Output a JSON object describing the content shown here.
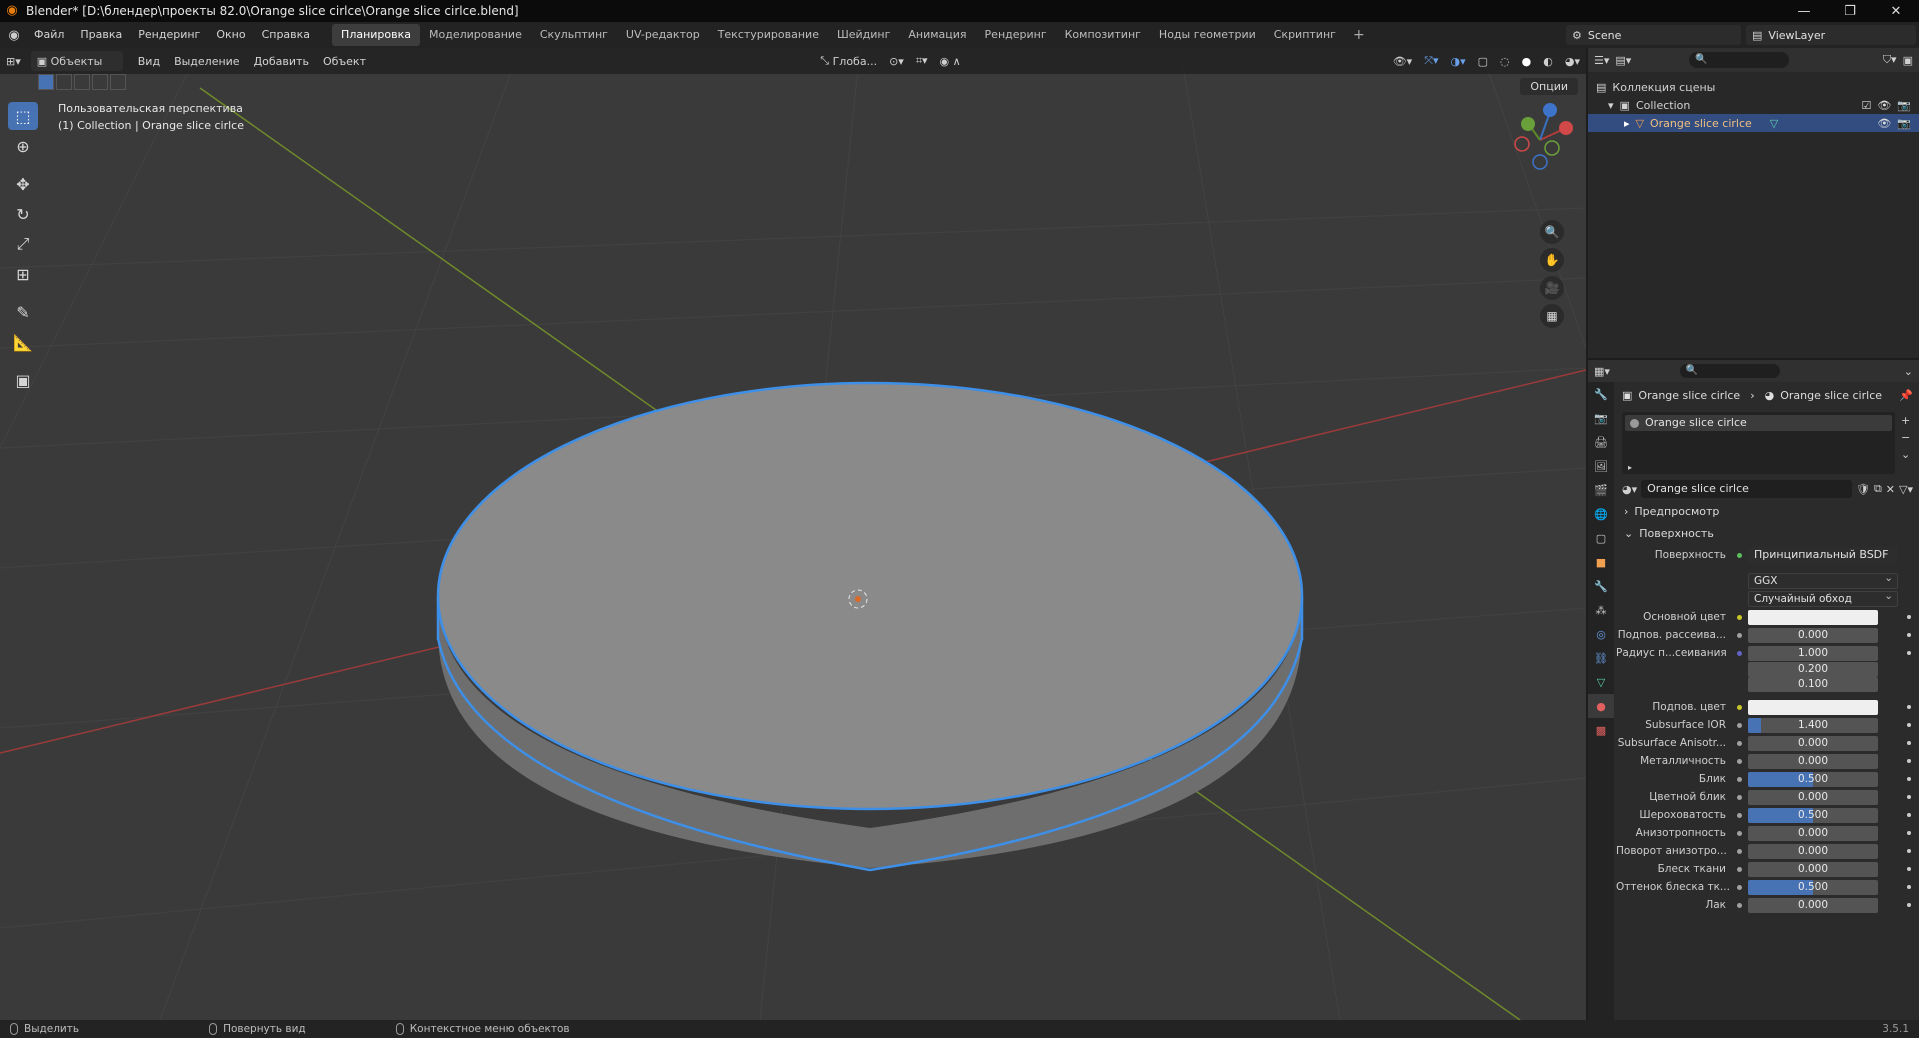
{
  "titlebar": {
    "title": "Blender* [D:\\блендер\\проекты 82.0\\Orange slice cirlce\\Orange slice cirlce.blend]",
    "minimize": "—",
    "restore": "❐",
    "close": "✕"
  },
  "topbar": {
    "menus": [
      "Файл",
      "Правка",
      "Рендеринг",
      "Окно",
      "Справка"
    ],
    "workspaces": [
      "Планировка",
      "Моделирование",
      "Скульптинг",
      "UV-редактор",
      "Текстурирование",
      "Шейдинг",
      "Анимация",
      "Рендеринг",
      "Композитинг",
      "Ноды геометрии",
      "Скриптинг"
    ],
    "active_workspace": "Планировка",
    "add_tab": "+",
    "scene": "Scene",
    "view_layer": "ViewLayer"
  },
  "viewport": {
    "mode": "Объекты",
    "menus": [
      "Вид",
      "Выделение",
      "Добавить",
      "Объект"
    ],
    "transform_orientation": "Глоба...",
    "options": "Опции",
    "view_name": "Пользовательская перспектива",
    "view_context": "(1) Collection | Orange slice cirlce",
    "gizmo_axes": {
      "x": "X",
      "y": "Y",
      "z": "Z"
    }
  },
  "outliner": {
    "root": "Коллекция сцены",
    "collection": "Collection",
    "object": "Orange slice cirlce"
  },
  "properties": {
    "breadcrumb_object": "Orange slice cirlce",
    "breadcrumb_material": "Orange slice cirlce",
    "slot_name": "Orange slice cirlce",
    "material_name": "Orange slice cirlce",
    "panel_preview": "Предпросмотр",
    "panel_surface": "Поверхность",
    "surface_label": "Поверхность",
    "surface_shader": "Принципиальный BSDF",
    "distribution": "GGX",
    "subsurface_method": "Случайный обход",
    "rows": [
      {
        "label": "Основной цвет",
        "kind": "color",
        "dot": "yellow"
      },
      {
        "label": "Подпов. рассеива...",
        "kind": "num",
        "value": "0.000",
        "fill": 0,
        "dot": "gray"
      },
      {
        "label": "Радиус п...сеивания",
        "kind": "num",
        "value": "1.000",
        "fill": 0,
        "dot": "blue"
      },
      {
        "label": "",
        "kind": "num",
        "value": "0.200",
        "fill": 0,
        "dot": "none"
      },
      {
        "label": "",
        "kind": "num",
        "value": "0.100",
        "fill": 0,
        "dot": "none"
      },
      {
        "label": "Подпов. цвет",
        "kind": "color",
        "dot": "yellow"
      },
      {
        "label": "Subsurface IOR",
        "kind": "num",
        "value": "1.400",
        "fill": 0.1,
        "dot": "gray"
      },
      {
        "label": "Subsurface Anisotr...",
        "kind": "num",
        "value": "0.000",
        "fill": 0,
        "dot": "gray"
      },
      {
        "label": "Металличность",
        "kind": "num",
        "value": "0.000",
        "fill": 0,
        "dot": "gray"
      },
      {
        "label": "Блик",
        "kind": "num",
        "value": "0.500",
        "fill": 0.5,
        "dot": "gray"
      },
      {
        "label": "Цветной блик",
        "kind": "num",
        "value": "0.000",
        "fill": 0,
        "dot": "gray"
      },
      {
        "label": "Шероховатость",
        "kind": "num",
        "value": "0.500",
        "fill": 0.5,
        "dot": "gray"
      },
      {
        "label": "Анизотропность",
        "kind": "num",
        "value": "0.000",
        "fill": 0,
        "dot": "gray"
      },
      {
        "label": "Поворот анизотро...",
        "kind": "num",
        "value": "0.000",
        "fill": 0,
        "dot": "gray"
      },
      {
        "label": "Блеск ткани",
        "kind": "num",
        "value": "0.000",
        "fill": 0,
        "dot": "gray"
      },
      {
        "label": "Оттенок блеска тк...",
        "kind": "num",
        "value": "0.500",
        "fill": 0.5,
        "dot": "gray"
      },
      {
        "label": "Лак",
        "kind": "num",
        "value": "0.000",
        "fill": 0,
        "dot": "gray"
      }
    ]
  },
  "statusbar": {
    "select": "Выделить",
    "rotate": "Повернуть вид",
    "context_menu": "Контекстное меню объектов",
    "version": "3.5.1"
  },
  "colors": {
    "accent": "#4772b3",
    "selection_outline": "#3d8fe8",
    "x_axis": "#b33a3a",
    "y_axis": "#7a9a2a",
    "outliner_selected": "#334d80"
  }
}
